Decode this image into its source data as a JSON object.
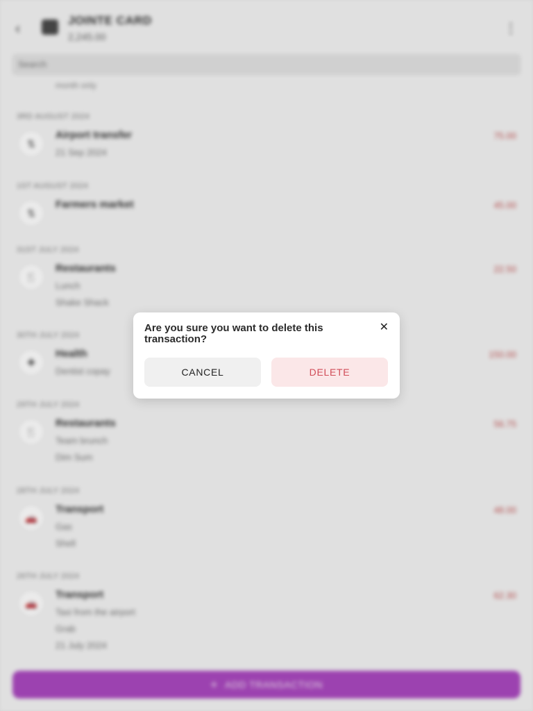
{
  "header": {
    "back_icon": "back-arrow-icon",
    "wallet_icon": "wallet-icon",
    "account_name": "JOINTE CARD",
    "account_balance": "2,245.00",
    "menu_icon": "more-icon"
  },
  "search": {
    "placeholder": "Search"
  },
  "list": {
    "tail_text": "month only",
    "groups": [
      {
        "date": "3RD AUGUST 2024",
        "title": "Airport transfer",
        "subs": [
          "21 Sep 2024"
        ],
        "amount": "75.00",
        "icon": "swap"
      },
      {
        "date": "1ST AUGUST 2024",
        "title": "Farmers market",
        "subs": [],
        "amount": "45.00",
        "icon": "swap"
      },
      {
        "date": "31ST JULY 2024",
        "title": "Restaurants",
        "subs": [
          "Lunch",
          "Shake Shack"
        ],
        "amount": "22.50",
        "icon": "fork"
      },
      {
        "date": "30TH JULY 2024",
        "title": "Health",
        "subs": [
          "Dentist copay"
        ],
        "amount": "150.00",
        "icon": "med"
      },
      {
        "date": "29TH JULY 2024",
        "title": "Restaurants",
        "subs": [
          "Team brunch",
          "Dim Sum"
        ],
        "amount": "56.75",
        "icon": "fork"
      },
      {
        "date": "28TH JULY 2024",
        "title": "Transport",
        "subs": [
          "Gas",
          "Shell"
        ],
        "amount": "48.00",
        "icon": "car"
      },
      {
        "date": "26TH JULY 2024",
        "title": "Transport",
        "subs": [
          "Taxi from the airport",
          "Grab",
          "21 July 2024"
        ],
        "amount": "62.30",
        "icon": "car"
      }
    ]
  },
  "fab": {
    "label": "ADD TRANSACTION",
    "icon": "plus-icon",
    "color": "#aa48bf"
  },
  "dialog": {
    "title": "Are you sure you want to delete this transaction?",
    "close_icon": "close-icon",
    "cancel_label": "CANCEL",
    "delete_label": "DELETE",
    "delete_color": "#d04c57"
  }
}
